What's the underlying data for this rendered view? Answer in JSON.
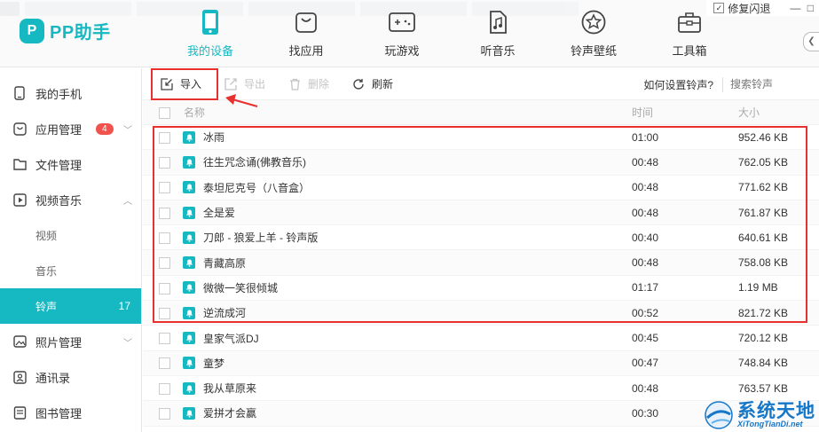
{
  "app": {
    "logo_mark": "P",
    "logo_text": "PP助手",
    "repair_label": "修复闪退",
    "window_controls": "— □"
  },
  "nav": [
    {
      "label": "我的设备",
      "icon": "phone-icon",
      "active": true
    },
    {
      "label": "找应用",
      "icon": "bag-icon",
      "active": false
    },
    {
      "label": "玩游戏",
      "icon": "gamepad-icon",
      "active": false
    },
    {
      "label": "听音乐",
      "icon": "music-icon",
      "active": false
    },
    {
      "label": "铃声壁纸",
      "icon": "star-icon",
      "active": false
    },
    {
      "label": "工具箱",
      "icon": "toolbox-icon",
      "active": false
    }
  ],
  "sidebar": {
    "items": [
      {
        "label": "我的手机",
        "icon": "phone-icon"
      },
      {
        "label": "应用管理",
        "icon": "app-icon",
        "badge": "4"
      },
      {
        "label": "文件管理",
        "icon": "folder-icon"
      },
      {
        "label": "视频音乐",
        "icon": "play-icon"
      }
    ],
    "sub_items": [
      {
        "label": "视频"
      },
      {
        "label": "音乐"
      },
      {
        "label": "铃声",
        "count": "17",
        "active": true
      }
    ],
    "items_after": [
      {
        "label": "照片管理",
        "icon": "photo-icon"
      },
      {
        "label": "通讯录",
        "icon": "contacts-icon"
      },
      {
        "label": "图书管理",
        "icon": "book-icon"
      }
    ]
  },
  "toolbar": {
    "import": "导入",
    "export": "导出",
    "delete": "删除",
    "refresh": "刷新",
    "help": "如何设置铃声?",
    "search_placeholder": "搜索铃声"
  },
  "table": {
    "headers": {
      "name": "名称",
      "time": "时间",
      "size": "大小"
    },
    "rows": [
      {
        "name": "冰雨",
        "time": "01:00",
        "size": "952.46 KB"
      },
      {
        "name": "往生咒念诵(佛教音乐)",
        "time": "00:48",
        "size": "762.05 KB"
      },
      {
        "name": "泰坦尼克号（八音盒）",
        "time": "00:48",
        "size": "771.62 KB"
      },
      {
        "name": "全是爱",
        "time": "00:48",
        "size": "761.87 KB"
      },
      {
        "name": "刀郎 - 狼爱上羊 - 铃声版",
        "time": "00:40",
        "size": "640.61 KB"
      },
      {
        "name": "青藏高原",
        "time": "00:48",
        "size": "758.08 KB"
      },
      {
        "name": "微微一笑很倾城",
        "time": "01:17",
        "size": "1.19 MB"
      },
      {
        "name": "逆流成河",
        "time": "00:52",
        "size": "821.72 KB"
      },
      {
        "name": "皇家气派DJ",
        "time": "00:45",
        "size": "720.12 KB"
      },
      {
        "name": "童梦",
        "time": "00:47",
        "size": "748.84 KB"
      },
      {
        "name": "我从草原来",
        "time": "00:48",
        "size": "763.57 KB"
      },
      {
        "name": "爱拼才会赢",
        "time": "00:30",
        "size": "--"
      }
    ]
  },
  "watermark": {
    "cn": "系统天地",
    "en": "XiTongTianDi.net"
  },
  "colors": {
    "accent": "#16b9c2",
    "badge": "#f0524d",
    "annotation": "#e8312f"
  }
}
